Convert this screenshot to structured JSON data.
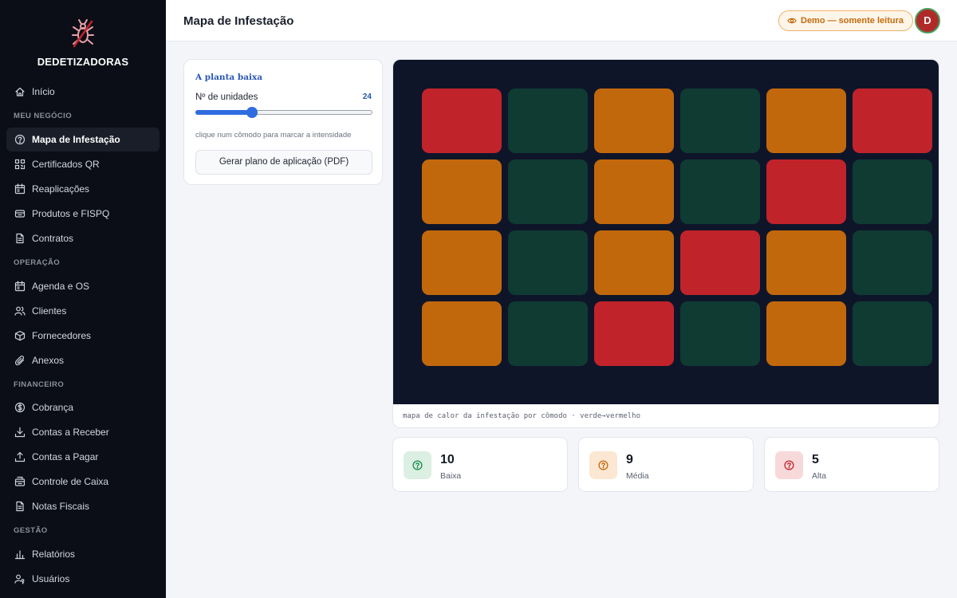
{
  "brand": {
    "name": "DEDETIZADORAS"
  },
  "sidebar": {
    "top_items": [
      {
        "label": "Início",
        "icon": "home-icon"
      }
    ],
    "sections": [
      {
        "title": "MEU NEGÓCIO",
        "items": [
          {
            "label": "Mapa de Infestação",
            "icon": "help-circle-icon",
            "active": true
          },
          {
            "label": "Certificados QR",
            "icon": "qr-code-icon"
          },
          {
            "label": "Reaplicações",
            "icon": "calendar-icon"
          },
          {
            "label": "Produtos e FISPQ",
            "icon": "box-icon"
          },
          {
            "label": "Contratos",
            "icon": "document-icon"
          }
        ]
      },
      {
        "title": "OPERAÇÃO",
        "items": [
          {
            "label": "Agenda e OS",
            "icon": "calendar-icon"
          },
          {
            "label": "Clientes",
            "icon": "users-icon"
          },
          {
            "label": "Fornecedores",
            "icon": "package-icon"
          },
          {
            "label": "Anexos",
            "icon": "paperclip-icon"
          }
        ]
      },
      {
        "title": "FINANCEIRO",
        "items": [
          {
            "label": "Cobrança",
            "icon": "dollar-circle-icon"
          },
          {
            "label": "Contas a Receber",
            "icon": "download-icon"
          },
          {
            "label": "Contas a Pagar",
            "icon": "upload-icon"
          },
          {
            "label": "Controle de Caixa",
            "icon": "cash-register-icon"
          },
          {
            "label": "Notas Fiscais",
            "icon": "document-icon"
          }
        ]
      },
      {
        "title": "GESTÃO",
        "items": [
          {
            "label": "Relatórios",
            "icon": "bar-chart-icon"
          },
          {
            "label": "Usuários",
            "icon": "user-key-icon"
          }
        ]
      }
    ]
  },
  "header": {
    "title": "Mapa de Infestação",
    "demo_badge": "Demo — somente leitura",
    "avatar_initial": "D",
    "avatar_color": "#b02a2a"
  },
  "panel": {
    "title": "A planta baixa",
    "units_label": "Nº de unidades",
    "units_value": "24",
    "units_fraction": 0.31,
    "hint": "clique num cômodo para marcar a intensidade",
    "pdf_button": "Gerar plano de aplicação (PDF)"
  },
  "heatmap": {
    "rows": 4,
    "cols": 6,
    "levels": [
      [
        "alta",
        "baixa",
        "media",
        "baixa",
        "media",
        "alta"
      ],
      [
        "media",
        "baixa",
        "media",
        "baixa",
        "alta",
        "baixa"
      ],
      [
        "media",
        "baixa",
        "media",
        "alta",
        "media",
        "baixa"
      ],
      [
        "media",
        "baixa",
        "alta",
        "baixa",
        "media",
        "baixa"
      ]
    ],
    "colors": {
      "baixa": "#0f3b33",
      "media": "#c2680c",
      "alta": "#c1232b"
    },
    "background": "#0f1529",
    "caption": "mapa de calor da infestação por cômodo · verde→vermelho"
  },
  "stats": [
    {
      "value": "10",
      "label": "Baixa",
      "color": "#178a4a",
      "bg": "#dcefe3"
    },
    {
      "value": "9",
      "label": "Média",
      "color": "#c36a0c",
      "bg": "#fbe7d2"
    },
    {
      "value": "5",
      "label": "Alta",
      "color": "#c1232b",
      "bg": "#f8d9da"
    }
  ]
}
